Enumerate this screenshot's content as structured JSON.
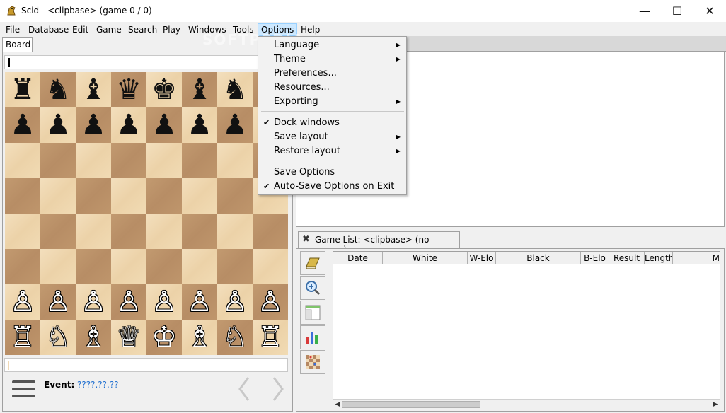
{
  "window": {
    "title": "Scid - <clipbase> (game 0 / 0)",
    "icon": "scid-app-icon",
    "minimize_glyph": "—",
    "maximize_glyph": "☐",
    "close_glyph": "✕"
  },
  "menubar": {
    "items": [
      "File",
      "Database",
      "Edit",
      "Game",
      "Search",
      "Play",
      "Windows",
      "Tools",
      "Options",
      "Help"
    ],
    "active": "Options"
  },
  "options_menu": {
    "items": [
      {
        "label": "Language",
        "submenu": true,
        "checked": false
      },
      {
        "label": "Theme",
        "submenu": true,
        "checked": false
      },
      {
        "label": "Preferences...",
        "submenu": false,
        "checked": false
      },
      {
        "label": "Resources...",
        "submenu": false,
        "checked": false
      },
      {
        "label": "Exporting",
        "submenu": true,
        "checked": false
      },
      {
        "label": "Dock windows",
        "submenu": false,
        "checked": true
      },
      {
        "label": "Save layout",
        "submenu": true,
        "checked": false
      },
      {
        "label": "Restore layout",
        "submenu": true,
        "checked": false
      },
      {
        "label": "Save Options",
        "submenu": false,
        "checked": false
      },
      {
        "label": "Auto-Save Options on Exit",
        "submenu": false,
        "checked": true
      }
    ],
    "check_glyph": "✔",
    "arrow_glyph": "▶"
  },
  "board": {
    "tab_label": "Board",
    "rows": [
      [
        "♜",
        "♞",
        "♝",
        "♛",
        "♚",
        "♝",
        "♞",
        "♜"
      ],
      [
        "♟",
        "♟",
        "♟",
        "♟",
        "♟",
        "♟",
        "♟",
        "♟"
      ],
      [
        "",
        "",
        "",
        "",
        "",
        "",
        "",
        ""
      ],
      [
        "",
        "",
        "",
        "",
        "",
        "",
        "",
        ""
      ],
      [
        "",
        "",
        "",
        "",
        "",
        "",
        "",
        ""
      ],
      [
        "",
        "",
        "",
        "",
        "",
        "",
        "",
        ""
      ],
      [
        "♙",
        "♙",
        "♙",
        "♙",
        "♙",
        "♙",
        "♙",
        "♙"
      ],
      [
        "♖",
        "♘",
        "♗",
        "♕",
        "♔",
        "♗",
        "♘",
        "♖"
      ]
    ],
    "colors": {
      "light": "#f0d9b5",
      "dark": "#b58863"
    },
    "event_label": "Event:",
    "event_value": "????.??.?? -"
  },
  "game_list": {
    "tab_title": "Game List: <clipbase> (no games)",
    "close_glyph": "✖",
    "columns": [
      "Date",
      "White",
      "W-Elo",
      "Black",
      "B-Elo",
      "Result",
      "Length",
      "M"
    ],
    "toolbar_icons": [
      "book-icon",
      "zoom-icon",
      "layout-icon",
      "bar-chart-icon",
      "checkerboard-icon"
    ],
    "scroll_left": "◀",
    "scroll_right": "▶"
  },
  "watermark": "SOFTPEDIA"
}
